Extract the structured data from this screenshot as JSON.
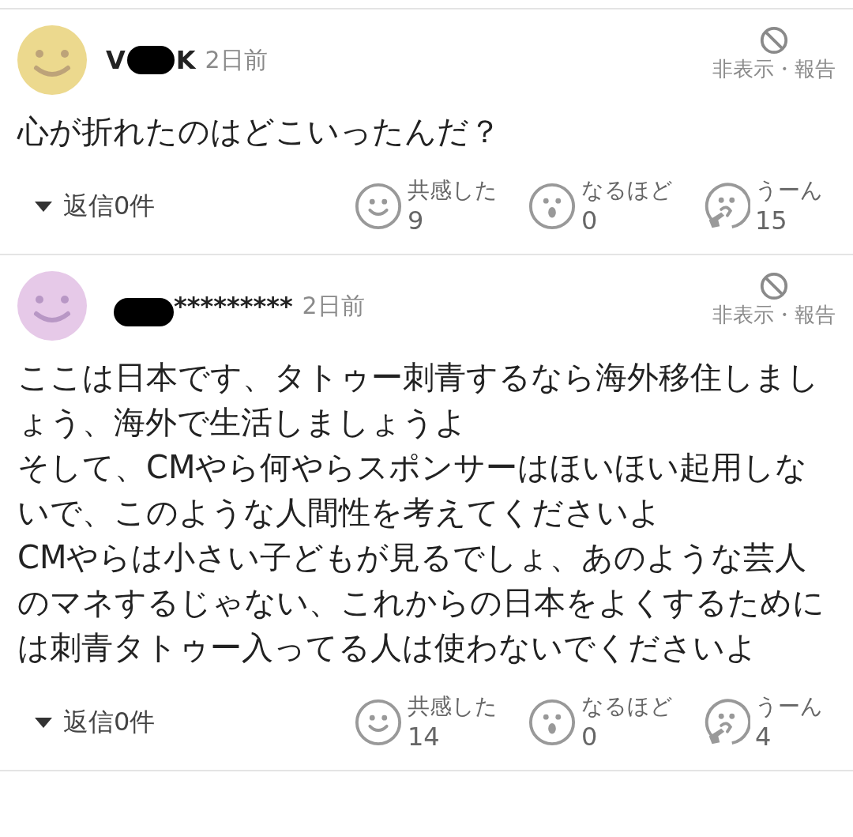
{
  "comments": [
    {
      "color": "#ecd98e",
      "name_segments": [
        {
          "kind": "text",
          "text": "V"
        },
        {
          "kind": "redaction"
        },
        {
          "kind": "text",
          "text": "K"
        }
      ],
      "time": "2日前",
      "hide_report": "非表示・報告",
      "body": [
        "心が折れたのはどこいったんだ？"
      ],
      "replies": "返信0件",
      "reactions": [
        {
          "kind": "smile",
          "label": "共感した",
          "count": "9"
        },
        {
          "kind": "surprise",
          "label": "なるほど",
          "count": "0"
        },
        {
          "kind": "hmm",
          "label": "うーん",
          "count": "15"
        }
      ]
    },
    {
      "color": "#e6c9e8",
      "name_segments": [
        {
          "kind": "redaction"
        },
        {
          "kind": "text",
          "text": "*********"
        }
      ],
      "time": "2日前",
      "hide_report": "非表示・報告",
      "body": [
        "ここは日本です、タトゥー刺青するなら海外移住しましょう、海外で生活しましょうよ",
        "そして、CMやら何やらスポンサーはほいほい起用しないで、このような人間性を考えてくださいよ",
        "CMやらは小さい子どもが見るでしょ、あのような芸人のマネするじゃない、これからの日本をよくするためには刺青タトゥー入ってる人は使わないでくださいよ"
      ],
      "replies": "返信0件",
      "reactions": [
        {
          "kind": "smile",
          "label": "共感した",
          "count": "14"
        },
        {
          "kind": "surprise",
          "label": "なるほど",
          "count": "0"
        },
        {
          "kind": "hmm",
          "label": "うーん",
          "count": "4"
        }
      ]
    }
  ]
}
